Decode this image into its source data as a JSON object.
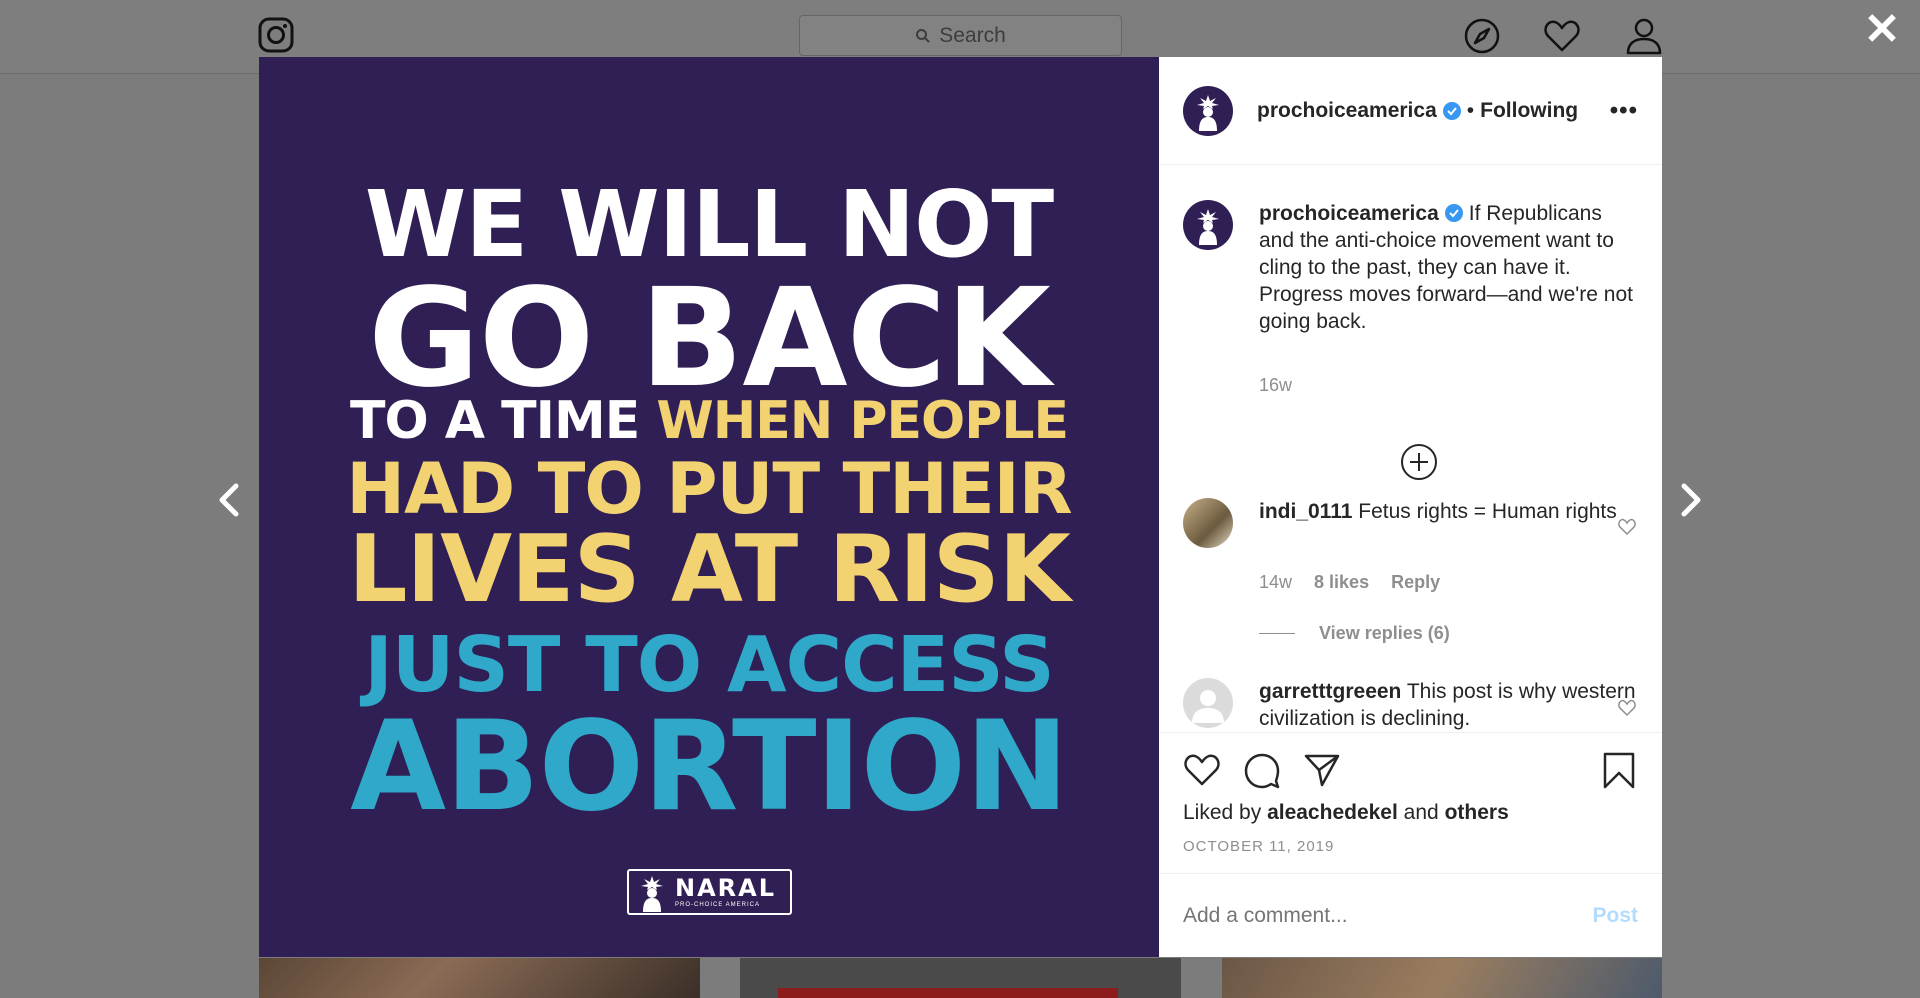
{
  "header": {
    "search_placeholder": "Search",
    "icons": [
      "instagram-icon",
      "search-icon",
      "explore-icon",
      "heart-icon",
      "profile-icon"
    ]
  },
  "poster": {
    "lines": [
      {
        "text": "WE WILL NOT"
      },
      {
        "text": "GO BACK"
      },
      {
        "text": "TO A TIME",
        "text2": "WHEN PEOPLE"
      },
      {
        "text": "HAD TO PUT THEIR"
      },
      {
        "text": "LIVES AT RISK"
      },
      {
        "text": "JUST TO ACCESS"
      },
      {
        "text": "ABORTION"
      }
    ],
    "logo_word": "NARAL",
    "logo_sub": "PRO-CHOICE AMERICA",
    "colors": {
      "background": "#2f1f55",
      "white": "#ffffff",
      "yellow": "#f3d271",
      "blue": "#2fa8c9"
    }
  },
  "post": {
    "username": "prochoiceamerica",
    "dot": "•",
    "follow_status": "Following",
    "more": "•••"
  },
  "caption": {
    "username": "prochoiceamerica",
    "text": "If Republicans and the anti-choice movement want to cling to the past, they can have it. Progress moves forward—and we're not going back.",
    "age": "16w"
  },
  "comments": [
    {
      "username": "indi_0111",
      "text": "Fetus rights = Human rights",
      "age": "14w",
      "likes": "8 likes",
      "reply": "Reply",
      "view_replies": "View replies (6)"
    },
    {
      "username": "garretttgreeen",
      "text": "This post is why western civilization is declining."
    }
  ],
  "footer": {
    "liked_prefix": "Liked by",
    "liked_user": "aleachedekel",
    "liked_and": "and",
    "liked_others": "others",
    "date": "OCTOBER 11, 2019",
    "comment_placeholder": "Add a comment...",
    "post_label": "Post"
  },
  "colors": {
    "verified": "#3897f0",
    "meta": "#8e8e8e",
    "post_disabled": "#b3dbff"
  }
}
